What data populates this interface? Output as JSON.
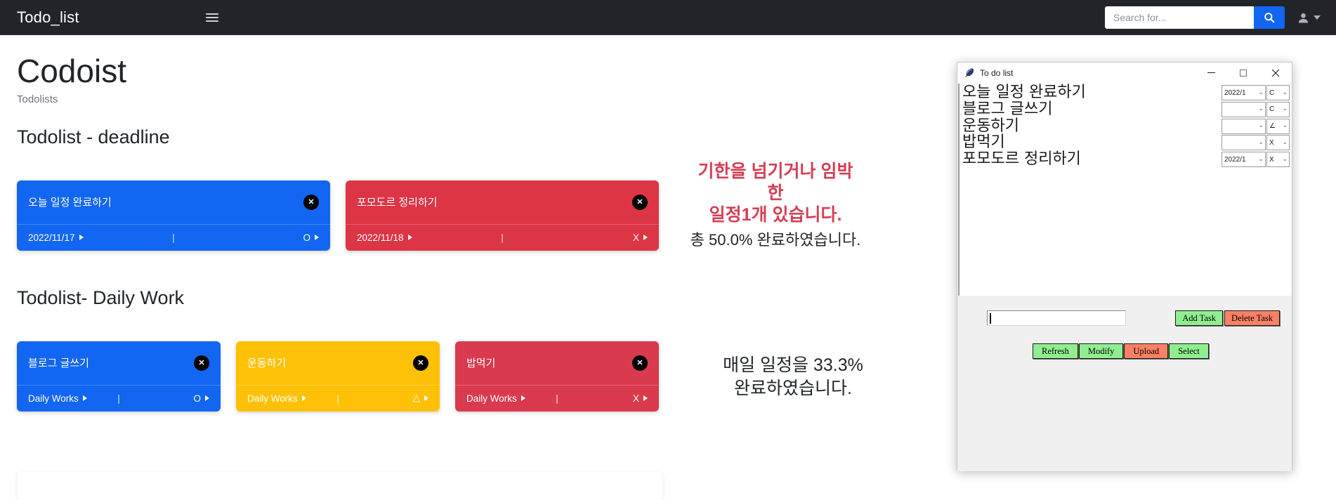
{
  "navbar": {
    "brand": "Todo_list",
    "menu_icon": "hamburger-icon",
    "search": {
      "placeholder": "Search for...",
      "value": "",
      "button_icon": "search-icon"
    },
    "user_icon": "user-icon",
    "caret_icon": "chevron-down-icon"
  },
  "page": {
    "title": "Codoist",
    "subtitle": "Todolists",
    "section_deadline": "Todolist - deadline",
    "section_daily": "Todolist- Daily Work"
  },
  "deadline_cards": [
    {
      "title": "오늘 일정 완료하기",
      "meta": "2022/11/17",
      "divider": "|",
      "state": "O",
      "color": "#1266f1",
      "close_icon": "close-circle-icon"
    },
    {
      "title": "포모도르 정리하기",
      "meta": "2022/11/18",
      "divider": "|",
      "state": "X",
      "color": "#dc3545",
      "close_icon": "close-circle-icon"
    }
  ],
  "daily_cards": [
    {
      "title": "블로그 글쓰기",
      "meta": "Daily Works",
      "divider": "|",
      "state": "O",
      "color": "#1266f1",
      "close_icon": "close-circle-icon"
    },
    {
      "title": "운동하기",
      "meta": "Daily Works",
      "divider": "|",
      "state": "△",
      "color": "#ffc107",
      "close_icon": "close-circle-icon"
    },
    {
      "title": "밥먹기",
      "meta": "Daily Works",
      "divider": "|",
      "state": "X",
      "color": "#d93a4e",
      "close_icon": "close-circle-icon"
    }
  ],
  "status": {
    "warn_line1": "기한을 넘기거나 임박",
    "warn_line2": "한",
    "warn_line3": "일정1개 있습니다.",
    "total_text": "총 50.0% 완료하였습니다.",
    "daily_line1": "매일 일정을 33.3%",
    "daily_line2": "완료하였습니다.",
    "warn_color": "#d43f54"
  },
  "popup": {
    "title": "To do list",
    "app_icon": "feather-icon",
    "minimize": "−",
    "maximize": "□",
    "close": "✕",
    "tasks": [
      {
        "name": "오늘 일정 완료하기",
        "date": "2022/1",
        "state": "C"
      },
      {
        "name": "블로그 글쓰기",
        "date": "",
        "state": "C"
      },
      {
        "name": "운동하기",
        "date": "",
        "state": "∠"
      },
      {
        "name": "밥먹기",
        "date": "",
        "state": "X"
      },
      {
        "name": "포모도르 정리하기",
        "date": "2022/1",
        "state": "X"
      }
    ],
    "entry_value": "",
    "buttons": {
      "add_task": "Add Task",
      "delete_task": "Delete Task",
      "refresh": "Refresh",
      "modify": "Modify",
      "upload": "Upload",
      "select": "Select"
    },
    "colors": {
      "green": "#90ee90",
      "salmon": "#fa8163"
    }
  }
}
